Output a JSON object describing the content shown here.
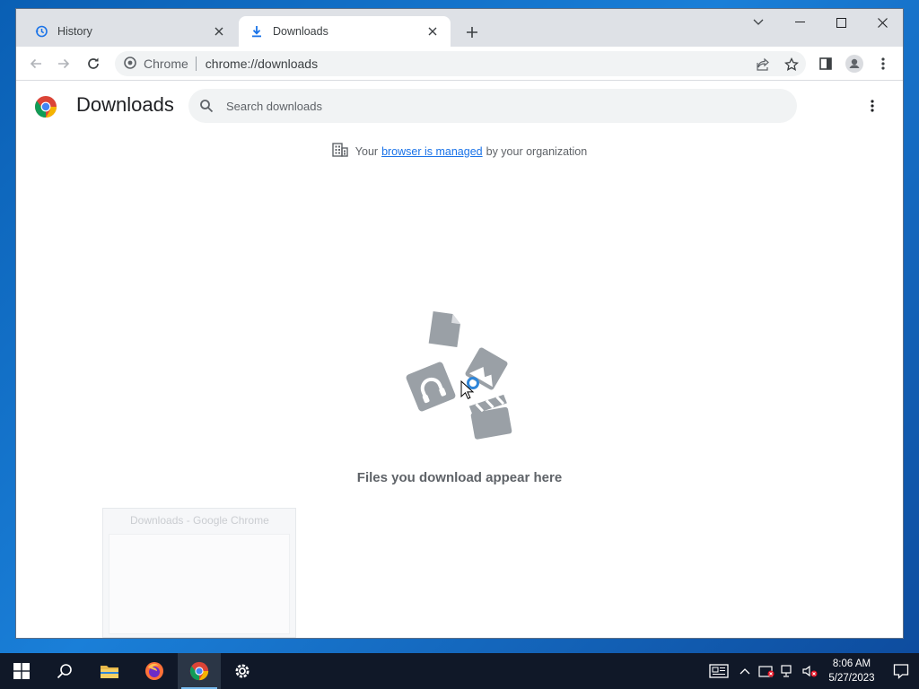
{
  "browser": {
    "tabs": [
      {
        "title": "History",
        "icon": "history-icon",
        "active": false
      },
      {
        "title": "Downloads",
        "icon": "download-icon",
        "active": true
      }
    ],
    "omnibox": {
      "site_label": "Chrome",
      "url": "chrome://downloads"
    }
  },
  "page": {
    "title": "Downloads",
    "search_placeholder": "Search downloads",
    "managed_notice": {
      "before": "Your",
      "link": "browser is managed",
      "after": "by your organization"
    },
    "empty_message": "Files you download appear here"
  },
  "ghost_window": {
    "title": "Downloads - Google Chrome"
  },
  "taskbar": {
    "apps": [
      "start-icon",
      "search-icon",
      "file-explorer-icon",
      "firefox-icon",
      "chrome-icon",
      "settings-icon"
    ],
    "active_app": "chrome-icon",
    "clock": {
      "time": "8:06 AM",
      "date": "5/27/2023"
    }
  },
  "colors": {
    "accent": "#1a73e8",
    "tabstrip": "#dee1e6",
    "taskbar": "#101828"
  }
}
